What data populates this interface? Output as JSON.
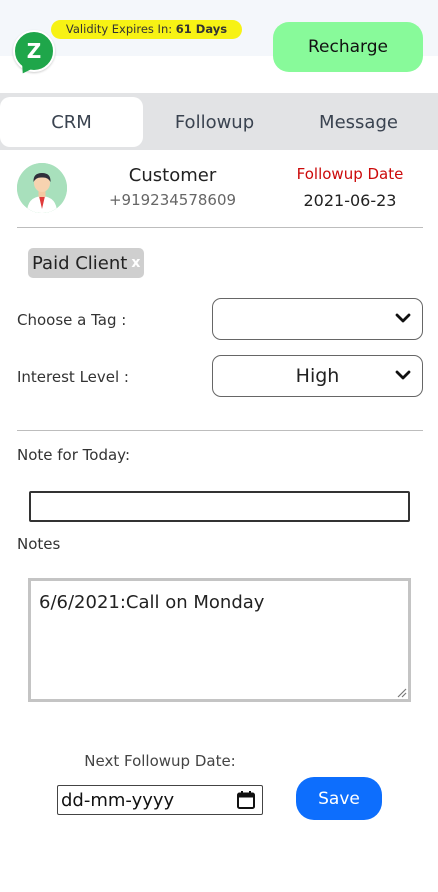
{
  "header": {
    "logo_letter": "Z",
    "validity_prefix": "Validity Expires In:",
    "validity_days": "61 Days",
    "recharge_label": "Recharge"
  },
  "tabs": [
    {
      "label": "CRM",
      "active": true
    },
    {
      "label": "Followup",
      "active": false
    },
    {
      "label": "Message",
      "active": false
    }
  ],
  "customer": {
    "name": "Customer",
    "phone": "+919234578609",
    "followup_label": "Followup Date",
    "followup_date": "2021-06-23"
  },
  "tag_chip": {
    "label": "Paid Client",
    "remove": "x"
  },
  "form": {
    "choose_tag_label": "Choose a Tag :",
    "choose_tag_value": "",
    "interest_label": "Interest Level :",
    "interest_value": "High",
    "note_today_label": "Note for Today:",
    "note_today_value": "",
    "notes_label": "Notes",
    "notes_value": "6/6/2021:Call on Monday",
    "next_followup_label": "Next Followup Date:",
    "next_followup_placeholder": "dd-mm-yyyy",
    "save_label": "Save"
  },
  "colors": {
    "accent_blue": "#0d6efd",
    "recharge_green": "#88fa9a",
    "validity_yellow": "#f7f214",
    "followup_red": "#cc0a0a",
    "logo_green": "#1fa64a"
  }
}
